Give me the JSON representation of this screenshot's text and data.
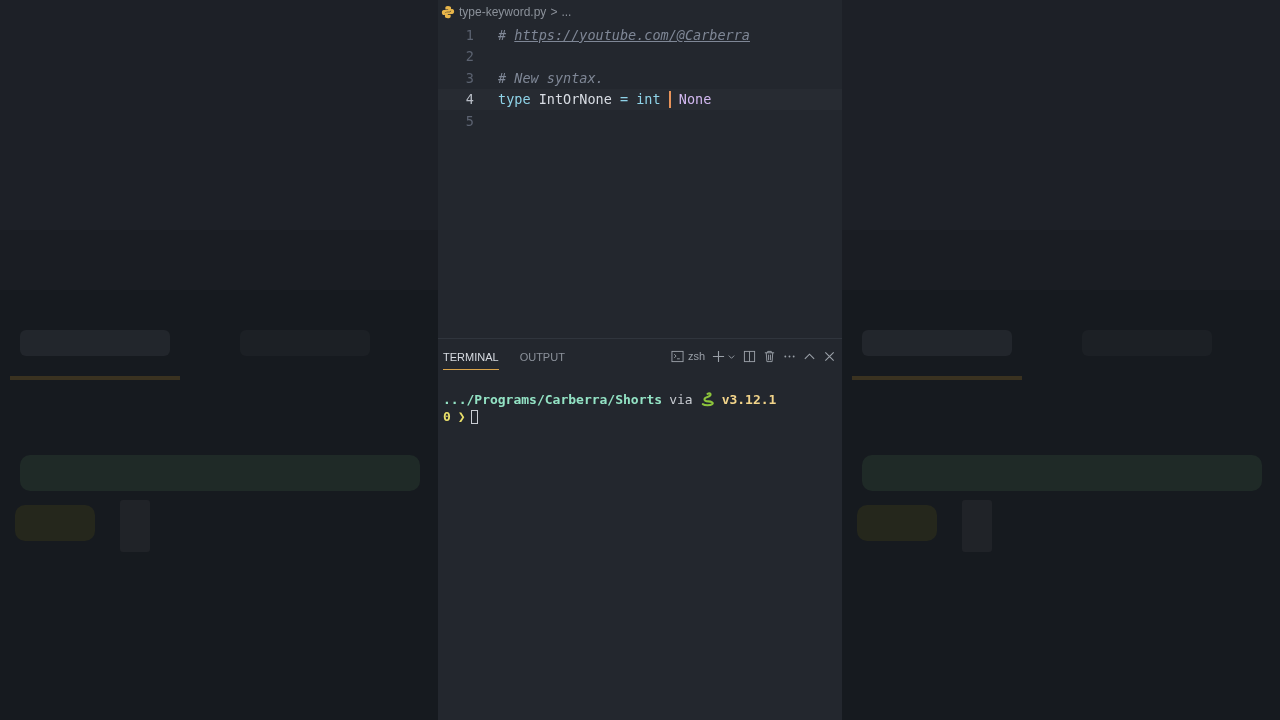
{
  "breadcrumb": {
    "file": "type-keyword.py",
    "separator": ">",
    "rest": "..."
  },
  "editor": {
    "lines": [
      {
        "number": "1",
        "current": false,
        "tokens": [
          {
            "kind": "comment",
            "text": "# "
          },
          {
            "kind": "link",
            "text": "https://youtube.com/@Carberra"
          }
        ]
      },
      {
        "number": "2",
        "current": false
      },
      {
        "number": "3",
        "current": false,
        "tokens": [
          {
            "kind": "comment",
            "text": "# New syntax."
          }
        ]
      },
      {
        "number": "4",
        "current": true,
        "tokens": [
          {
            "kind": "keyword",
            "text": "type"
          },
          {
            "kind": "plain",
            "text": " IntOrNone "
          },
          {
            "kind": "operator",
            "text": "="
          },
          {
            "kind": "builtin",
            "text": " int "
          },
          {
            "kind": "caret"
          },
          {
            "kind": "constant",
            "text": " None"
          }
        ]
      },
      {
        "number": "5",
        "current": false
      }
    ]
  },
  "panel": {
    "tabs": [
      {
        "label": "TERMINAL",
        "selected": true
      },
      {
        "label": "OUTPUT",
        "selected": false
      }
    ],
    "shell": "zsh"
  },
  "terminal": {
    "path": ".../Programs/Carberra/Shorts",
    "via": "via",
    "version": "v3.12.1",
    "status": "0",
    "prompt": "❯"
  }
}
